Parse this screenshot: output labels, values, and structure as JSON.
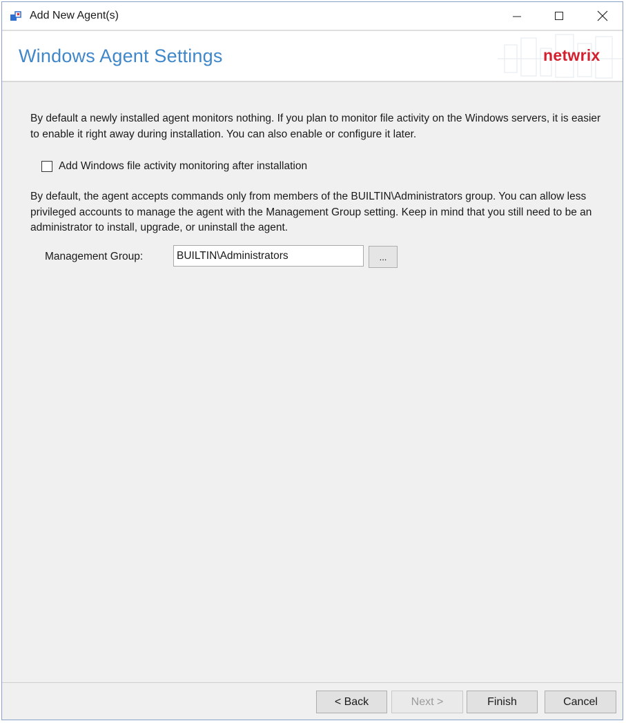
{
  "window": {
    "title": "Add New Agent(s)",
    "controls": {
      "minimize": "minimize-icon",
      "maximize": "maximize-icon",
      "close": "close-icon"
    }
  },
  "header": {
    "title": "Windows Agent Settings",
    "brand": "netwrix",
    "colors": {
      "title": "#3f87c9",
      "brand": "#d3202f"
    }
  },
  "content": {
    "paragraph1": "By default a newly installed agent monitors nothing. If you plan to monitor file activity on the Windows servers, it is easier to enable it right away during installation. You can also enable or configure it later.",
    "checkbox": {
      "label": "Add Windows file activity monitoring after installation",
      "checked": false
    },
    "paragraph2": "By default, the agent accepts commands only from members of the BUILTIN\\Administrators group.  You can allow less privileged accounts to manage the agent with the Management Group setting.  Keep in mind that you still need to be an administrator to install, upgrade, or uninstall the agent.",
    "management_group": {
      "label": "Management Group:",
      "value": "BUILTIN\\Administrators",
      "browse_label": "..."
    }
  },
  "footer": {
    "back_label": "< Back",
    "next_label": "Next >",
    "finish_label": "Finish",
    "cancel_label": "Cancel"
  }
}
